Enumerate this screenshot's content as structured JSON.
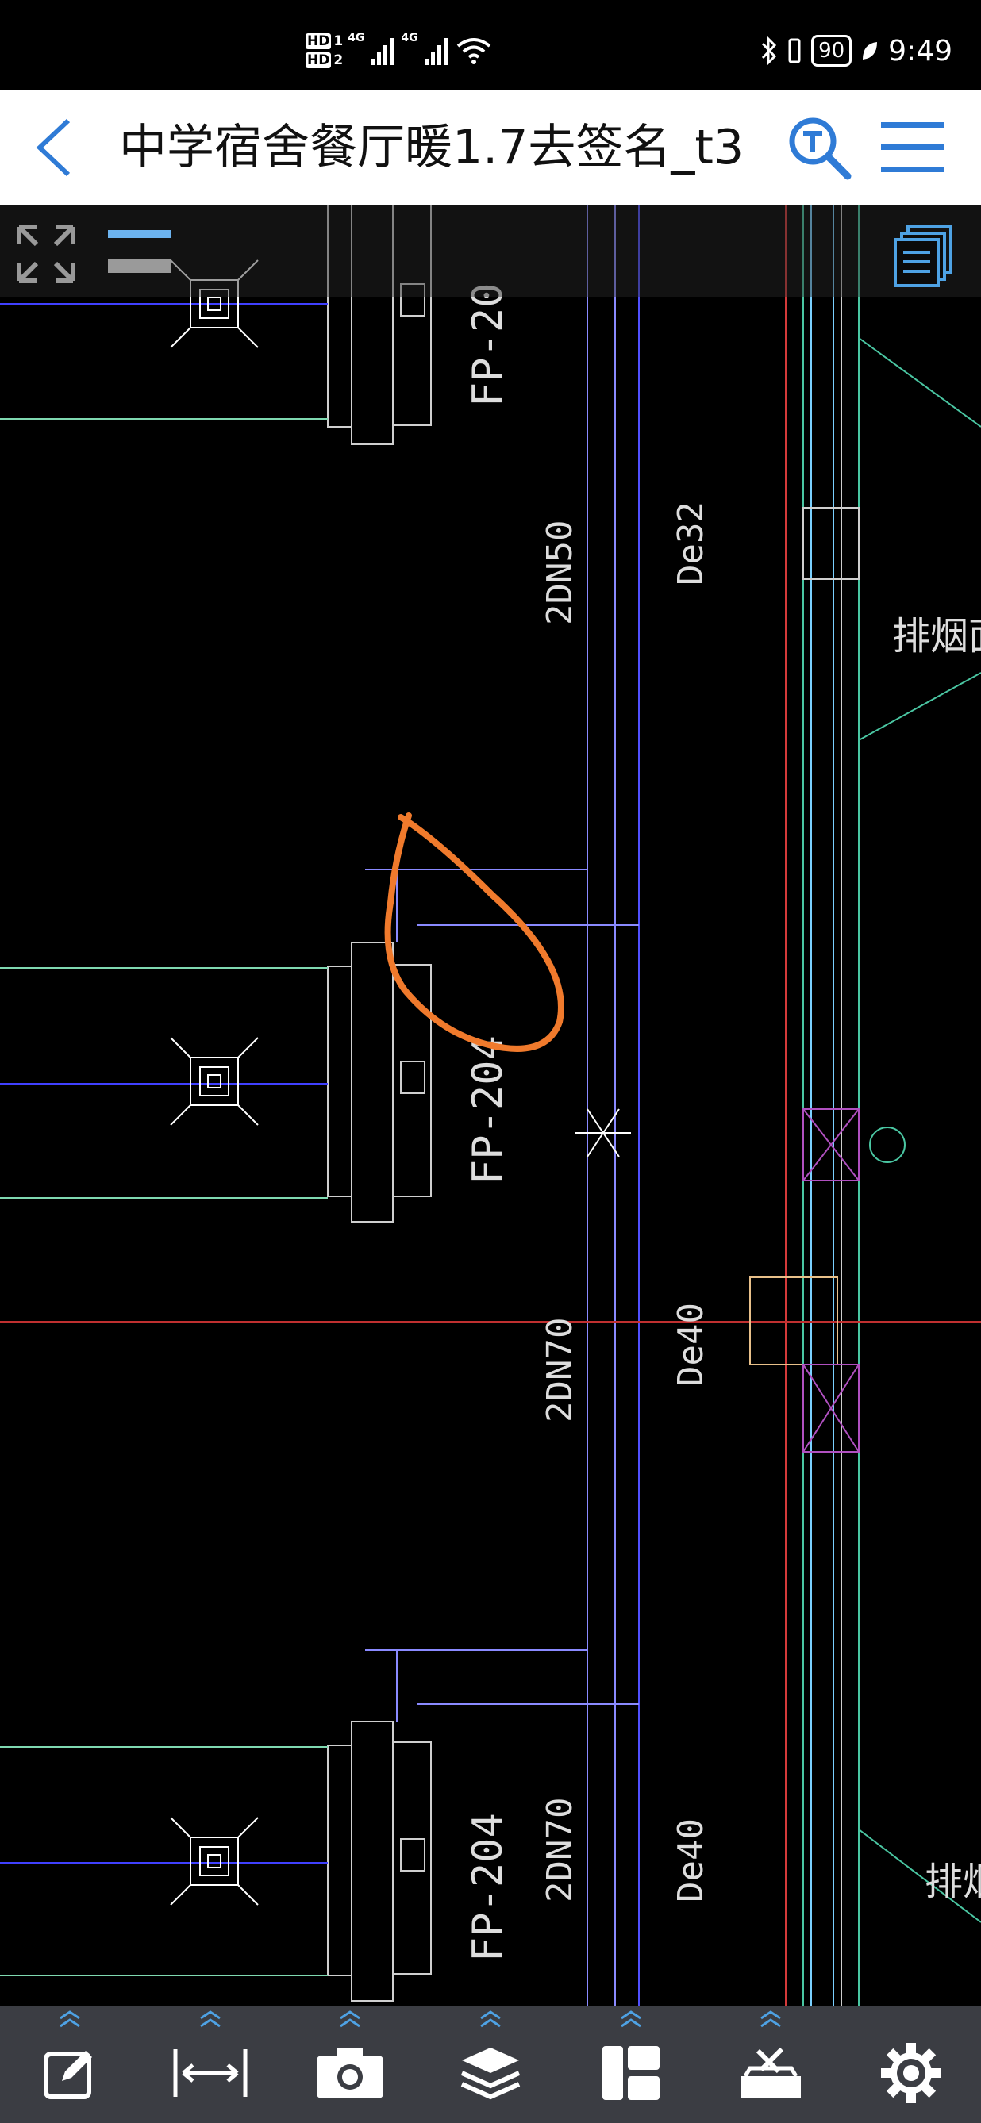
{
  "status": {
    "sim1": "HD",
    "sim1_slot": "1",
    "sim2": "HD",
    "sim2_slot": "2",
    "net1": "4G",
    "net2": "4G",
    "battery": "90",
    "time": "9:49"
  },
  "header": {
    "title": "中学宿舍餐厅暖1.7去签名_t3"
  },
  "drawing": {
    "labels": {
      "fp_top": "FP-20",
      "fp_mid": "FP-204",
      "fp_bot": "FP-204",
      "dn50": "2DN50",
      "de32": "De32",
      "dn70_mid": "2DN70",
      "de40_mid": "De40",
      "dn70_bot": "2DN70",
      "de40_bot": "De40",
      "smoke_top": "排烟面",
      "smoke_bot": "排烟"
    }
  },
  "colors": {
    "accent": "#2f7bd6",
    "annotation": "#f07a2c",
    "toolbar_bg": "#3b3d43"
  },
  "toolbar": {
    "icons": [
      "edit-icon",
      "measure-icon",
      "camera-icon",
      "layers-icon",
      "layout-icon",
      "toolbox-icon",
      "settings-icon"
    ]
  }
}
